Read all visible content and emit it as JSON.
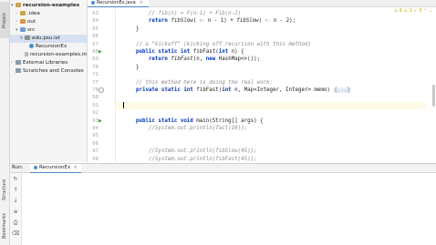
{
  "side_tabs": {
    "project": "Project",
    "structure": "Structure",
    "bookmarks": "Bookmarks"
  },
  "project_tree": [
    {
      "label": "recursion-examples",
      "indent": 0,
      "chev": "▾",
      "icon": "folder",
      "bold": true
    },
    {
      "label": ".idea",
      "indent": 1,
      "chev": "›",
      "icon": "folder"
    },
    {
      "label": "out",
      "indent": 1,
      "chev": "›",
      "icon": "folder orange"
    },
    {
      "label": "src",
      "indent": 1,
      "chev": "▾",
      "icon": "folder blue"
    },
    {
      "label": "edu.psu.ist",
      "indent": 2,
      "chev": "▾",
      "icon": "pkg",
      "selected": true
    },
    {
      "label": "RecursionEx",
      "indent": 3,
      "chev": "",
      "icon": "cls"
    },
    {
      "label": "recursion-examples.iml",
      "indent": 2,
      "chev": "",
      "icon": "file"
    },
    {
      "label": "External Libraries",
      "indent": 0,
      "chev": "›",
      "icon": "lib"
    },
    {
      "label": "Scratches and Consoles",
      "indent": 0,
      "chev": "",
      "icon": "lib"
    }
  ],
  "editor": {
    "tab_label": "RecursionEx.java",
    "tab_close": "×",
    "inspections": "⚠ 6  ⚠ 1  ✓ 3  ⌃  ⌄",
    "lines": [
      {
        "num": "63",
        "segments": [
          {
            "t": "        // fib(n) = F(n-1) + Fib(n-2)",
            "c": "comment"
          }
        ]
      },
      {
        "num": "64",
        "segments": [
          {
            "t": "        ",
            "c": ""
          },
          {
            "t": "return ",
            "c": "kw"
          },
          {
            "t": "fibSlow",
            "c": "fn"
          },
          {
            "t": "( ",
            "c": ""
          },
          {
            "t": "n: ",
            "c": "param-hint"
          },
          {
            "t": "n - 1) + ",
            "c": ""
          },
          {
            "t": "fibSlow",
            "c": "fn"
          },
          {
            "t": "( ",
            "c": ""
          },
          {
            "t": "n: ",
            "c": "param-hint"
          },
          {
            "t": "n - 2);",
            "c": ""
          }
        ]
      },
      {
        "num": "65",
        "segments": [
          {
            "t": "    }",
            "c": ""
          }
        ]
      },
      {
        "num": "66",
        "segments": []
      },
      {
        "num": "67",
        "segments": [
          {
            "t": "    // a \"kickoff\" (kicking off recursion with this method)",
            "c": "comment"
          }
        ]
      },
      {
        "num": "68",
        "segments": [
          {
            "t": "    ",
            "c": ""
          },
          {
            "t": "public static int ",
            "c": "kw"
          },
          {
            "t": "fibFast(",
            "c": ""
          },
          {
            "t": "int ",
            "c": "kw"
          },
          {
            "t": "n) {",
            "c": ""
          }
        ]
      },
      {
        "num": "69",
        "segments": [
          {
            "t": "        ",
            "c": ""
          },
          {
            "t": "return ",
            "c": "kw"
          },
          {
            "t": "fibFast",
            "c": "fn"
          },
          {
            "t": "(n, ",
            "c": ""
          },
          {
            "t": "new ",
            "c": "kw"
          },
          {
            "t": "HashMap<>());",
            "c": ""
          }
        ]
      },
      {
        "num": "70",
        "segments": [
          {
            "t": "    }",
            "c": ""
          }
        ]
      },
      {
        "num": "71",
        "segments": []
      },
      {
        "num": "77",
        "segments": [
          {
            "t": "    // this method here is doing the real work:",
            "c": "comment"
          }
        ]
      },
      {
        "num": "78",
        "segments": [
          {
            "t": "    ",
            "c": ""
          },
          {
            "t": "private static int ",
            "c": "kw"
          },
          {
            "t": "fibFast(",
            "c": ""
          },
          {
            "t": "int ",
            "c": "kw"
          },
          {
            "t": "n, Map<Integer, Integer> memo) ",
            "c": ""
          },
          {
            "t": "{...}",
            "c": "fold"
          }
        ]
      },
      {
        "num": "90",
        "segments": []
      },
      {
        "num": "91",
        "segments": [],
        "current": true
      },
      {
        "num": "92",
        "segments": []
      },
      {
        "num": "93",
        "segments": [
          {
            "t": "    ",
            "c": ""
          },
          {
            "t": "public static void ",
            "c": "kw"
          },
          {
            "t": "main(String[] args) {",
            "c": ""
          }
        ]
      },
      {
        "num": "94",
        "segments": [
          {
            "t": "        //System.out.println(fact(10));",
            "c": "comment"
          }
        ]
      },
      {
        "num": "95",
        "segments": []
      },
      {
        "num": "96",
        "segments": []
      },
      {
        "num": "97",
        "segments": [
          {
            "t": "        //System.out.println(fibSlow(45));",
            "c": "comment"
          }
        ]
      },
      {
        "num": "98",
        "segments": [
          {
            "t": "        //System.out.println(fibFast(45));",
            "c": "comment"
          }
        ]
      }
    ]
  },
  "run_panel": {
    "title": "Run:",
    "tab_label": "RecursionEx",
    "tab_close": "×",
    "tools": [
      {
        "name": "rerun-icon",
        "glyph": "↻"
      },
      {
        "name": "up-icon",
        "glyph": "↑"
      },
      {
        "name": "down-icon",
        "glyph": "↓"
      },
      {
        "name": "wrap-icon",
        "glyph": "≡"
      },
      {
        "name": "print-icon",
        "glyph": "⎙"
      },
      {
        "name": "trash-icon",
        "glyph": "⌫"
      }
    ]
  }
}
